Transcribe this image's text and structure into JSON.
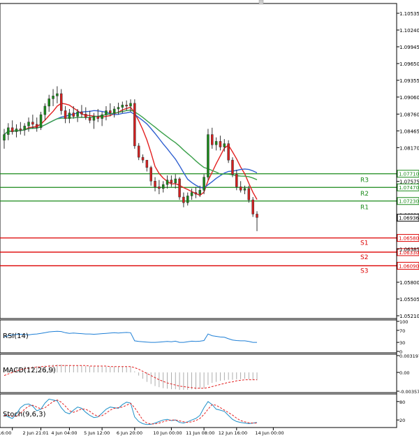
{
  "chart_data": {
    "type": "candlestick",
    "price_axis": {
      "ylim": [
        1.0521,
        1.0596
      ],
      "ticks": [
        "1.10535",
        "1.10240",
        "1.09945",
        "1.09650",
        "1.09355",
        "1.09060",
        "1.08760",
        "1.08465",
        "1.08170",
        "1.07575",
        "1.06990",
        "1.06385",
        "1.05800",
        "1.05505",
        "1.05210"
      ]
    },
    "time_axis": {
      "labels": [
        "y 16:00",
        "2 Jun 21:01",
        "4 Jun 04:00",
        "5 Jun 12:00",
        "6 Jun 20:00",
        "10 Jun 00:00",
        "11 Jun 08:00",
        "12 Jun 16:00",
        "14 Jun 00:00"
      ],
      "label_index": [
        2,
        9,
        16,
        24,
        32,
        41,
        49,
        57,
        66
      ]
    },
    "last_price": "1.06936",
    "levels": [
      {
        "name": "R3",
        "value": 1.0771,
        "label": "1.07710",
        "color": "#1a8a1a"
      },
      {
        "name": "R2",
        "value": 1.0747,
        "label": "1.07470",
        "color": "#1a8a1a"
      },
      {
        "name": "R1",
        "value": 1.0723,
        "label": "1.07230",
        "color": "#1a8a1a"
      },
      {
        "name": "S1",
        "value": 1.0658,
        "label": "1.06580",
        "color": "#dd0000"
      },
      {
        "name": "S2",
        "value": 1.0633,
        "label": "1.06330",
        "color": "#dd0000"
      },
      {
        "name": "S3",
        "value": 1.0609,
        "label": "1.06090",
        "color": "#dd0000"
      }
    ],
    "candles": [
      [
        1.083,
        1.085,
        1.0815,
        1.084
      ],
      [
        1.084,
        1.086,
        1.083,
        1.0852
      ],
      [
        1.0852,
        1.0865,
        1.084,
        1.0845
      ],
      [
        1.0845,
        1.0858,
        1.0835,
        1.085
      ],
      [
        1.085,
        1.0862,
        1.084,
        1.0848
      ],
      [
        1.0848,
        1.086,
        1.0838,
        1.0855
      ],
      [
        1.0855,
        1.087,
        1.0845,
        1.0862
      ],
      [
        1.0862,
        1.0875,
        1.085,
        1.0858
      ],
      [
        1.0858,
        1.087,
        1.0845,
        1.0852
      ],
      [
        1.0852,
        1.088,
        1.0848,
        1.0875
      ],
      [
        1.0875,
        1.0895,
        1.0865,
        1.089
      ],
      [
        1.089,
        1.091,
        1.088,
        1.0903
      ],
      [
        1.0903,
        1.092,
        1.089,
        1.0908
      ],
      [
        1.0908,
        1.0925,
        1.0895,
        1.0912
      ],
      [
        1.0912,
        1.092,
        1.0875,
        1.0882
      ],
      [
        1.0882,
        1.089,
        1.086,
        1.0868
      ],
      [
        1.0868,
        1.0885,
        1.086,
        1.0878
      ],
      [
        1.0878,
        1.089,
        1.0868,
        1.0872
      ],
      [
        1.0872,
        1.0885,
        1.0862,
        1.088
      ],
      [
        1.088,
        1.0892,
        1.087,
        1.0876
      ],
      [
        1.0876,
        1.0888,
        1.0866,
        1.087
      ],
      [
        1.087,
        1.0882,
        1.086,
        1.0865
      ],
      [
        1.0865,
        1.0878,
        1.085,
        1.0872
      ],
      [
        1.0872,
        1.0885,
        1.0862,
        1.0868
      ],
      [
        1.0868,
        1.088,
        1.0855,
        1.0875
      ],
      [
        1.0875,
        1.089,
        1.0865,
        1.0882
      ],
      [
        1.0882,
        1.0895,
        1.0872,
        1.0878
      ],
      [
        1.0878,
        1.089,
        1.087,
        1.0885
      ],
      [
        1.0885,
        1.0896,
        1.0875,
        1.0888
      ],
      [
        1.0888,
        1.0898,
        1.0878,
        1.0892
      ],
      [
        1.0892,
        1.09,
        1.0882,
        1.089
      ],
      [
        1.089,
        1.0902,
        1.088,
        1.0895
      ],
      [
        1.0895,
        1.0902,
        1.0815,
        1.082
      ],
      [
        1.082,
        1.0825,
        1.0795,
        1.08
      ],
      [
        1.08,
        1.0805,
        1.079,
        1.0795
      ],
      [
        1.0795,
        1.079,
        1.0775,
        1.0782
      ],
      [
        1.0782,
        1.0785,
        1.075,
        1.0758
      ],
      [
        1.0758,
        1.0765,
        1.074,
        1.0748
      ],
      [
        1.0748,
        1.076,
        1.0735,
        1.0745
      ],
      [
        1.0745,
        1.0758,
        1.0738,
        1.0752
      ],
      [
        1.0752,
        1.0768,
        1.0745,
        1.076
      ],
      [
        1.076,
        1.0768,
        1.0748,
        1.0755
      ],
      [
        1.0755,
        1.077,
        1.0745,
        1.0762
      ],
      [
        1.0762,
        1.0765,
        1.0725,
        1.073
      ],
      [
        1.073,
        1.0738,
        1.0712,
        1.072
      ],
      [
        1.072,
        1.0738,
        1.0715,
        1.0732
      ],
      [
        1.0732,
        1.0745,
        1.0725,
        1.0738
      ],
      [
        1.0738,
        1.0748,
        1.0728,
        1.0735
      ],
      [
        1.0735,
        1.075,
        1.073,
        1.0742
      ],
      [
        1.0742,
        1.077,
        1.0735,
        1.0765
      ],
      [
        1.0765,
        1.085,
        1.076,
        1.084
      ],
      [
        1.084,
        1.0852,
        1.0815,
        1.0822
      ],
      [
        1.0822,
        1.0835,
        1.0812,
        1.0828
      ],
      [
        1.0828,
        1.0838,
        1.0812,
        1.0818
      ],
      [
        1.0818,
        1.0832,
        1.081,
        1.0824
      ],
      [
        1.0824,
        1.083,
        1.079,
        1.0795
      ],
      [
        1.0795,
        1.08,
        1.0765,
        1.077
      ],
      [
        1.077,
        1.0778,
        1.0742,
        1.0748
      ],
      [
        1.0748,
        1.0758,
        1.0738,
        1.0742
      ],
      [
        1.0742,
        1.075,
        1.0735,
        1.0745
      ],
      [
        1.0745,
        1.075,
        1.072,
        1.0725
      ],
      [
        1.0725,
        1.073,
        1.0695,
        1.07
      ],
      [
        1.07,
        1.0705,
        1.067,
        1.0694
      ]
    ],
    "moving_averages": [
      {
        "color": "#e32020"
      },
      {
        "color": "#3060d0"
      },
      {
        "color": "#3aa04a"
      }
    ],
    "panels": [
      {
        "name": "RSI(14)",
        "ticks": [
          "100",
          "70",
          "30",
          "0"
        ],
        "ylim": [
          0,
          100
        ],
        "series": [
          {
            "color": "#1e7fd6",
            "values": [
              48,
              52,
              55,
              56,
              57,
              56,
              55,
              57,
              58,
              60,
              62,
              65,
              66,
              67,
              66,
              62,
              60,
              61,
              60,
              59,
              58,
              58,
              57,
              58,
              59,
              60,
              61,
              62,
              61,
              62,
              63,
              62,
              35,
              33,
              32,
              31,
              30,
              30,
              31,
              32,
              33,
              32,
              34,
              30,
              30,
              32,
              34,
              33,
              34,
              36,
              58,
              52,
              50,
              48,
              47,
              42,
              38,
              36,
              35,
              35,
              33,
              30,
              30
            ]
          }
        ]
      },
      {
        "name": "MACD(12,26,9)",
        "ticks": [
          "0.003197",
          "0.00",
          "-0.003573"
        ],
        "ylim": [
          -0.003573,
          0.003197
        ],
        "histogram": [
          0.0005,
          0.0007,
          0.0008,
          0.0009,
          0.001,
          0.0011,
          0.0011,
          0.0012,
          0.0012,
          0.0012,
          0.0013,
          0.0014,
          0.0015,
          0.0015,
          0.0015,
          0.0014,
          0.0014,
          0.0013,
          0.0013,
          0.0013,
          0.0012,
          0.0012,
          0.0012,
          0.0012,
          0.0011,
          0.0011,
          0.0011,
          0.0011,
          0.0011,
          0.0011,
          0.0011,
          0.0011,
          0.0002,
          -0.0006,
          -0.0012,
          -0.0018,
          -0.0022,
          -0.0026,
          -0.0028,
          -0.003,
          -0.0031,
          -0.0032,
          -0.0032,
          -0.0033,
          -0.0033,
          -0.0033,
          -0.0032,
          -0.0032,
          -0.0031,
          -0.003,
          -0.0024,
          -0.002,
          -0.0018,
          -0.0016,
          -0.0015,
          -0.0014,
          -0.0014,
          -0.0013,
          -0.0013,
          -0.0012,
          -0.0013,
          -0.0014,
          -0.0015
        ],
        "signal": [
          -0.0006,
          -0.0003,
          0.0,
          0.0003,
          0.0005,
          0.0007,
          0.0008,
          0.0009,
          0.001,
          0.0011,
          0.0011,
          0.0012,
          0.0012,
          0.0013,
          0.0013,
          0.0013,
          0.0013,
          0.0013,
          0.0013,
          0.0013,
          0.0013,
          0.0012,
          0.0012,
          0.0012,
          0.0012,
          0.0012,
          0.0011,
          0.0011,
          0.0011,
          0.0011,
          0.0011,
          0.0011,
          0.0009,
          0.0006,
          0.0002,
          -0.0002,
          -0.0006,
          -0.001,
          -0.0014,
          -0.0017,
          -0.002,
          -0.0022,
          -0.0024,
          -0.0026,
          -0.0027,
          -0.0028,
          -0.0029,
          -0.003,
          -0.003,
          -0.003,
          -0.0029,
          -0.0027,
          -0.0025,
          -0.0023,
          -0.0021,
          -0.0019,
          -0.0018,
          -0.0016,
          -0.0015,
          -0.0014,
          -0.0014,
          -0.0014,
          -0.0014
        ]
      },
      {
        "name": "Stoch(9,6,3)",
        "ticks": [
          "80",
          "20"
        ],
        "ylim": [
          0,
          100
        ],
        "series": [
          {
            "color": "#1e90c8",
            "values": [
              38,
              30,
              25,
              40,
              60,
              70,
              72,
              65,
              50,
              55,
              75,
              88,
              85,
              82,
              60,
              45,
              40,
              52,
              62,
              58,
              45,
              35,
              28,
              30,
              42,
              55,
              62,
              60,
              58,
              70,
              78,
              75,
              30,
              15,
              8,
              5,
              6,
              10,
              15,
              20,
              22,
              18,
              20,
              12,
              10,
              14,
              20,
              25,
              35,
              60,
              80,
              70,
              55,
              52,
              48,
              35,
              22,
              15,
              12,
              10,
              8,
              10,
              12
            ]
          },
          {
            "color": "#e32020",
            "dash": "3,2",
            "values": [
              35,
              35,
              32,
              32,
              42,
              55,
              65,
              68,
              62,
              56,
              60,
              70,
              80,
              85,
              78,
              65,
              50,
              45,
              50,
              56,
              55,
              48,
              38,
              32,
              34,
              42,
              52,
              58,
              60,
              62,
              68,
              74,
              60,
              40,
              20,
              10,
              7,
              7,
              10,
              14,
              18,
              20,
              20,
              17,
              14,
              12,
              14,
              18,
              25,
              38,
              55,
              70,
              68,
              60,
              52,
              44,
              36,
              26,
              18,
              14,
              11,
              10,
              10
            ]
          }
        ]
      }
    ]
  }
}
